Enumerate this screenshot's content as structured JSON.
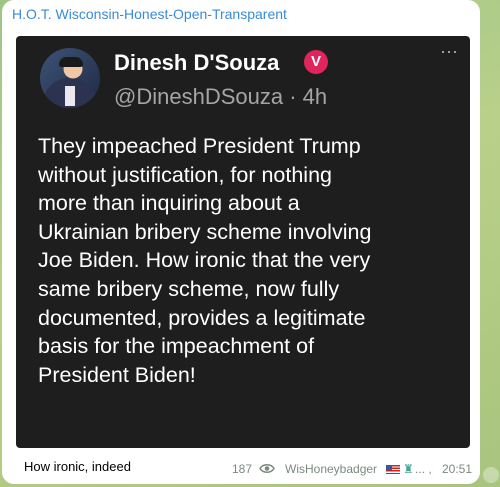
{
  "message": {
    "channel_name": "H.O.T. Wisconsin-Honest-Open-Transparent",
    "tweet": {
      "author_name": "Dinesh D'Souza",
      "verified_mark": "V",
      "handle_time": "@DineshDSouza · 4h",
      "more_icon": "⋯",
      "text": "They impeached President Trump\nwithout justification, for nothing\nmore than inquiring about a\nUkrainian bribery scheme involving\nJoe Biden.  How ironic that the very\nsame bribery scheme, now fully\ndocumented, provides a legitimate\nbasis for the impeachment of\nPresident Biden!"
    },
    "caption": "How ironic, indeed",
    "views": "187",
    "signature": "WisHoneybadger",
    "signature_icons": [
      "us-flag-icon",
      "statue-of-liberty-icon"
    ],
    "signature_suffix": "... ,",
    "time": "20:51",
    "colors": {
      "channel": "#3a8bd6",
      "embed_bg": "#1e1e1e",
      "verified": "#e0245e",
      "meta": "#7b8a80"
    }
  }
}
